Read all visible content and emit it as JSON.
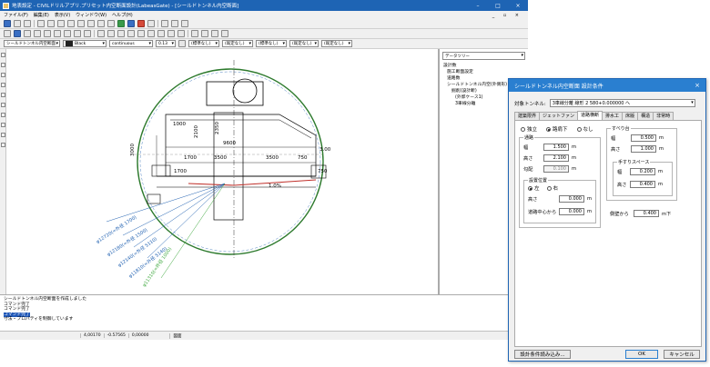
{
  "window": {
    "title": "地表設定 - CIVILドリルアプリ.プリセット内空断面設計(LabeasGate) - [シールドトンネル内空断面]",
    "controls": [
      "–",
      "□",
      "×"
    ]
  },
  "menu": [
    "ファイル(F)",
    "編集(E)",
    "表示(V)",
    "ウィンドウ(W)",
    "ヘルプ(H)"
  ],
  "menu_mdi": "_ ▫ ×",
  "toolbar3": {
    "layer": "シールドトンネル内空断面",
    "color": "Black",
    "linetype": "continuous",
    "width": "0.13",
    "c1": "(標準なし)",
    "c2": "(既定なし)",
    "c3": "(標準なし)",
    "c4": "(既定なし)",
    "c5": "(既定なし)"
  },
  "drawing": {
    "dims": [
      "1700",
      "3500",
      "3500",
      "750",
      "1700",
      "9600",
      "750",
      "1000",
      "3000",
      "2350",
      "2100",
      "3.00",
      "1.0%"
    ],
    "leaders": [
      "φ12720(=外径 1700)",
      "φ12180(=外径 1500)",
      "φ12140(=外径 5110)",
      "φ11810(=外径 5140)",
      "φ11310(=外径 1000)"
    ]
  },
  "tree": {
    "dropdown": "データツリー",
    "items": [
      "設計数",
      "施工断面設定",
      "道路数",
      "シールドトンネル内空(外側形)",
      "掘削(設計断)",
      "(外郭ケース1)",
      "3車線分離"
    ]
  },
  "output": {
    "lines": [
      "シールドトンネル内空断面を作成しました",
      "コマンド完了",
      "コマンド完了",
      "コマンド完了",
      "寸法・プロパティを制御しています"
    ]
  },
  "status": [
    "4,00170",
    "-0.57565",
    "0,00000",
    "図面"
  ],
  "dialog": {
    "title": "シールドトンネル内空断面 設計条件",
    "target_label": "対象トンネル:",
    "target_value": "3車線分離 線形 2 580+0.000000 へ",
    "tabs": [
      "建築限界",
      "ジェットファン",
      "道路横断",
      "排水工",
      "床版",
      "構造",
      "非常時"
    ],
    "active_tab": 2,
    "radios": [
      "独立",
      "路肩下",
      "なし"
    ],
    "road_group": "通路",
    "road_fields": [
      {
        "label": "幅",
        "value": "1.500",
        "unit": "m"
      },
      {
        "label": "高さ",
        "value": "2.100",
        "unit": "m"
      },
      {
        "label": "勾配",
        "value": "0.100",
        "unit": "m"
      }
    ],
    "position_group": "設置位置",
    "position_radios": [
      "左",
      "右"
    ],
    "position_fields": [
      {
        "label": "高さ",
        "value": "0.000",
        "unit": "m"
      },
      {
        "label": "道路中心から",
        "value": "0.000",
        "unit": "m"
      }
    ],
    "curb_group": "すべり台",
    "curb_fields": [
      {
        "label": "幅",
        "value": "0.500",
        "unit": "m"
      },
      {
        "label": "高さ",
        "value": "1.000",
        "unit": "m"
      }
    ],
    "handrail_group": "手すりスペース",
    "handrail_fields": [
      {
        "label": "幅",
        "value": "0.200",
        "unit": "m"
      },
      {
        "label": "高さ",
        "value": "0.400",
        "unit": "m"
      }
    ],
    "side_label": "側壁から",
    "side_value": "0.400",
    "side_unit": "m下",
    "load_button": "設計条件読み込み...",
    "ok_button": "OK",
    "cancel_button": "キャンセル"
  }
}
